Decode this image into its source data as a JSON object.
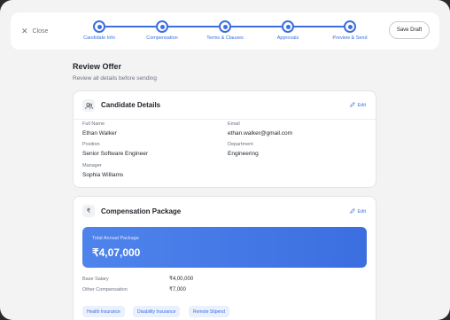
{
  "topbar": {
    "close_label": "Close",
    "save_draft_label": "Save Draft",
    "steps": [
      {
        "label": "Candidate Info"
      },
      {
        "label": "Compensation"
      },
      {
        "label": "Terms & Clauses"
      },
      {
        "label": "Approvals"
      },
      {
        "label": "Preview & Send"
      }
    ]
  },
  "page": {
    "title": "Review Offer",
    "subtitle": "Review all details before sending"
  },
  "candidate": {
    "title": "Candidate Details",
    "edit_label": "Edit",
    "full_name_label": "Full Name",
    "full_name": "Ethan Walker",
    "email_label": "Email",
    "email": "ethan.walker@gmail.com",
    "position_label": "Position",
    "position": "Senior Software Engineer",
    "department_label": "Department",
    "department": "Engineering",
    "manager_label": "Manager",
    "manager": "Sophia Williams"
  },
  "compensation": {
    "title": "Compensation Package",
    "currency_symbol": "₹",
    "edit_label": "Edit",
    "total_label": "Total Annual Package",
    "total_value": "₹4,07,000",
    "base_label": "Base Salary",
    "base_value": "₹4,00,000",
    "other_label": "Other Compensation",
    "other_value": "₹7,000",
    "benefits": [
      "Health Insurance",
      "Disability Insurance",
      "Remote Stipend"
    ]
  },
  "colors": {
    "accent": "#3b6fe0",
    "background": "#f3f3f3",
    "card": "#ffffff"
  },
  "icons": {
    "close": "close-icon",
    "candidate": "users-icon",
    "compensation": "rupee-icon",
    "edit": "edit-icon"
  }
}
